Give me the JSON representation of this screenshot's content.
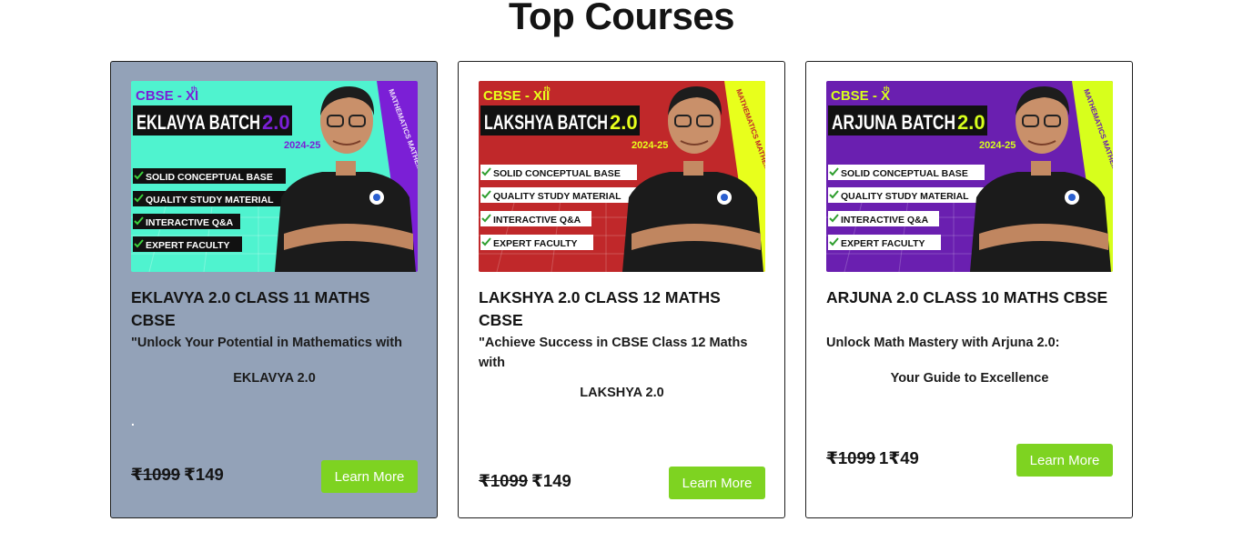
{
  "section": {
    "title": "Top Courses"
  },
  "colors": {
    "highlight_card": "#93a2b8",
    "button": "#7ed321",
    "check": "#3bd13b"
  },
  "courses": [
    {
      "banner": {
        "grade": "CBSE - XI",
        "grade_sup": "th",
        "batch": "EKLAVYA BATCH",
        "version": "2.0",
        "year": "2024-25",
        "features": [
          "SOLID CONCEPTUAL BASE",
          "QUALITY STUDY MATERIAL",
          "INTERACTIVE Q&A",
          "EXPERT FACULTY"
        ],
        "side_text": "MATHEMATICS MATHEMATICS MATHEMATIC",
        "theme": {
          "bg": "#4ff3cf",
          "side": "#7b1fd6",
          "grade": "#7b1fd6",
          "version": "#7b1fd6",
          "year": "#7b1fd6"
        }
      },
      "title": "EKLAVYA 2.0 CLASS 11 MATHS CBSE",
      "description": "\"Unlock Your Potential in Mathematics with",
      "subline": "EKLAVYA 2.0",
      "extra": ".",
      "old_price": "₹1099",
      "price": "₹149",
      "button": "Learn More"
    },
    {
      "banner": {
        "grade": "CBSE - XII",
        "grade_sup": "th",
        "batch": "LAKSHYA BATCH",
        "version": "2.0",
        "year": "2024-25",
        "features": [
          "SOLID CONCEPTUAL BASE",
          "QUALITY STUDY MATERIAL",
          "INTERACTIVE Q&A",
          "EXPERT FACULTY"
        ],
        "side_text": "MATHEMATICS MATHEMATICS MATHEMATIC",
        "theme": {
          "bg": "#c0282a",
          "side": "#e8ff1c",
          "grade": "#e8ff1c",
          "version": "#e8ff1c",
          "year": "#e8ff1c"
        }
      },
      "title": "LAKSHYA 2.0 CLASS 12 MATHS CBSE",
      "description": "\"Achieve Success in CBSE Class 12 Maths with",
      "subline": "LAKSHYA 2.0",
      "old_price": "₹1099",
      "price": "₹149",
      "button": "Learn More"
    },
    {
      "banner": {
        "grade": "CBSE - X",
        "grade_sup": "th",
        "batch": "ARJUNA BATCH",
        "version": "2.0",
        "year": "2024-25",
        "features": [
          "SOLID CONCEPTUAL BASE",
          "QUALITY STUDY MATERIAL",
          "INTERACTIVE Q&A",
          "EXPERT FACULTY"
        ],
        "side_text": "MATHEMATICS MATHEMATICS MATHEMATIC",
        "theme": {
          "bg": "#6a1fb0",
          "side": "#d7ff1c",
          "grade": "#d7ff1c",
          "version": "#d7ff1c",
          "year": "#d7ff1c"
        }
      },
      "title": "ARJUNA 2.0 CLASS 10 MATHS CBSE",
      "description": "Unlock Math Mastery with Arjuna 2.0:",
      "subline": "Your Guide to Excellence",
      "old_price": "₹1099",
      "price": "1₹49",
      "button": "Learn More"
    }
  ]
}
